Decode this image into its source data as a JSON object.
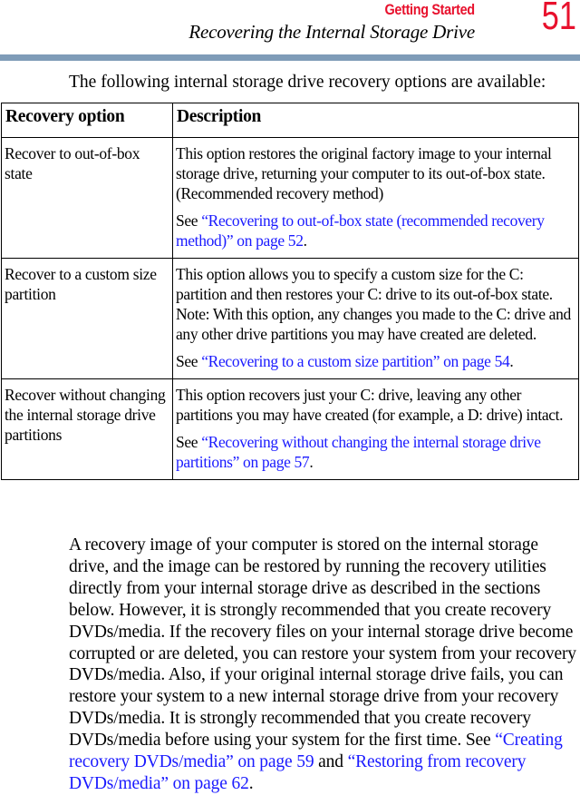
{
  "header": {
    "section": "Getting Started",
    "subtitle": "Recovering the Internal Storage Drive",
    "page_number": "51",
    "accent_color": "#e8112d",
    "bar_color": "#7f9cb8"
  },
  "intro": "The following internal storage drive recovery options are available:",
  "table": {
    "headers": [
      "Recovery option",
      "Description"
    ],
    "rows": [
      {
        "option": "Recover to out-of-box state",
        "description": "This option restores the original factory image to your internal storage drive, returning your computer to its out-of-box state. (Recommended recovery method)",
        "see_prefix": "See ",
        "see_link": "“Recovering to out-of-box state (recommended recovery method)” on page 52",
        "see_suffix": "."
      },
      {
        "option": "Recover to a custom size partition",
        "description": "This option allows you to specify a custom size for the C: partition and then restores your C: drive to its out-of-box state. Note: With this option, any changes you made to the C: drive and any other drive partitions you may have created are deleted.",
        "see_prefix": "See ",
        "see_link": "“Recovering to a custom size partition” on page 54",
        "see_suffix": "."
      },
      {
        "option": "Recover without changing the internal storage drive partitions",
        "description": "This option recovers just your C: drive, leaving any other partitions you may have created (for example, a D: drive) intact.",
        "see_prefix": "See ",
        "see_link": "“Recovering without changing the internal storage drive partitions” on page 57",
        "see_suffix": "."
      }
    ]
  },
  "body": {
    "text": "A recovery image of your computer is stored on the internal storage drive, and the image can be restored by running the recovery utilities directly from your internal storage drive as described in the sections below. However, it is strongly recommended that you create recovery DVDs/media. If the recovery files on your internal storage drive become corrupted or are deleted, you can restore your system from your recovery DVDs/media. Also, if your original internal storage drive fails, you can restore your system to a new internal storage drive from your recovery DVDs/media. It is strongly recommended that you create recovery DVDs/media before using your system for the first time. See ",
    "link1": "“Creating recovery DVDs/media” on page 59",
    "and": " and ",
    "link2": "“Restoring from recovery DVDs/media” on page 62",
    "end": "."
  },
  "link_color": "#1a1aff"
}
